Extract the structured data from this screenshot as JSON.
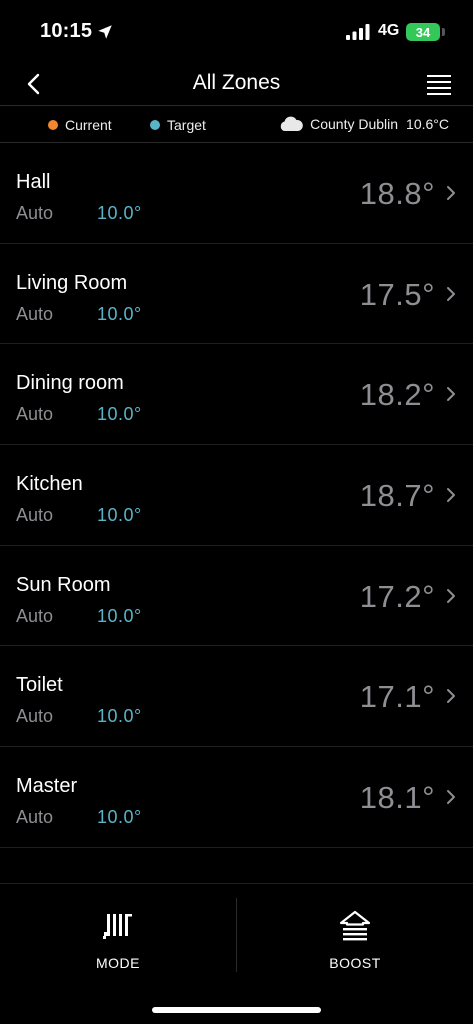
{
  "status_bar": {
    "time": "10:15",
    "network": "4G",
    "battery": "34",
    "location_icon": "location-arrow-icon",
    "signal_icon": "cellular-signal-icon"
  },
  "nav": {
    "title": "All Zones",
    "back_icon": "chevron-left-icon",
    "menu_icon": "hamburger-menu-icon"
  },
  "legend": {
    "current_label": "Current",
    "current_color": "#f0862e",
    "target_label": "Target",
    "target_color": "#5ab4c8",
    "weather_icon": "cloud-icon",
    "location": "County Dublin",
    "temperature": "10.6°C"
  },
  "zones": [
    {
      "name": "Hall",
      "mode": "Auto",
      "target": "10.0°",
      "current": "18.8°"
    },
    {
      "name": "Living Room",
      "mode": "Auto",
      "target": "10.0°",
      "current": "17.5°"
    },
    {
      "name": "Dining room",
      "mode": "Auto",
      "target": "10.0°",
      "current": "18.2°"
    },
    {
      "name": "Kitchen",
      "mode": "Auto",
      "target": "10.0°",
      "current": "18.7°"
    },
    {
      "name": "Sun Room",
      "mode": "Auto",
      "target": "10.0°",
      "current": "17.2°"
    },
    {
      "name": "Toilet",
      "mode": "Auto",
      "target": "10.0°",
      "current": "17.1°"
    },
    {
      "name": "Master",
      "mode": "Auto",
      "target": "10.0°",
      "current": "18.1°"
    }
  ],
  "bottom_bar": {
    "mode_label": "MODE",
    "mode_icon": "radiator-icon",
    "boost_label": "BOOST",
    "boost_icon": "boost-arrow-icon"
  }
}
